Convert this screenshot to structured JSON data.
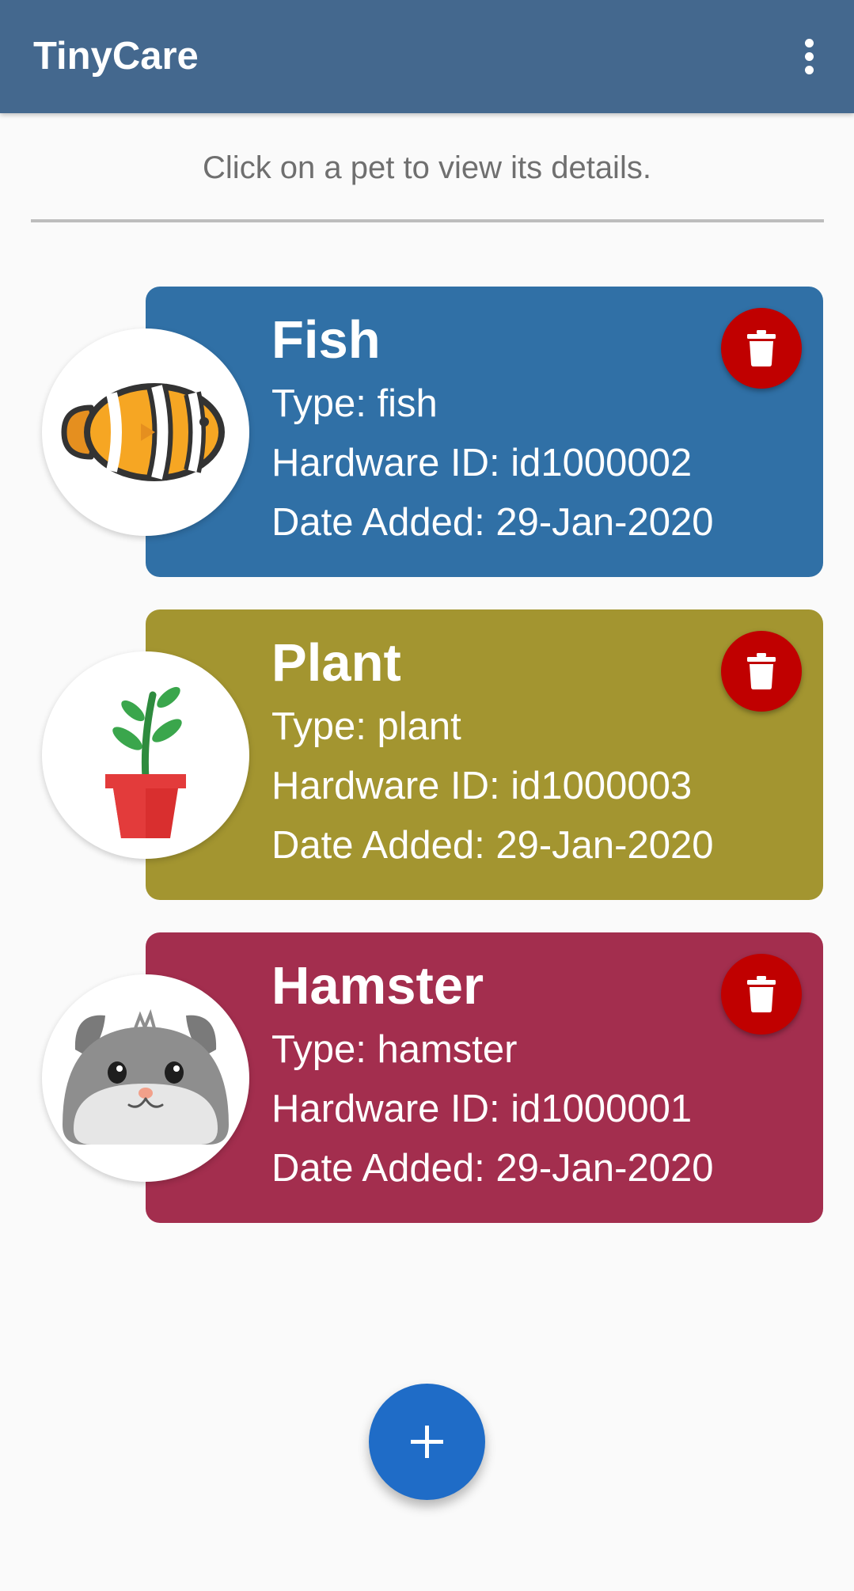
{
  "app_bar": {
    "title": "TinyCare",
    "menu_icon": "more-vert-icon",
    "color": "#44688e"
  },
  "hint": "Click on a pet to view its details.",
  "pets": [
    {
      "name": "Fish",
      "type_line": "Type: fish",
      "hardware_line": "Hardware ID: id1000002",
      "date_line": "Date Added: 29-Jan-2020",
      "avatar_icon": "clownfish-icon",
      "color": "#3070a6"
    },
    {
      "name": "Plant",
      "type_line": "Type: plant",
      "hardware_line": "Hardware ID: id1000003",
      "date_line": "Date Added: 29-Jan-2020",
      "avatar_icon": "potted-plant-icon",
      "color": "#a39530"
    },
    {
      "name": "Hamster",
      "type_line": "Type: hamster",
      "hardware_line": "Hardware ID: id1000001",
      "date_line": "Date Added: 29-Jan-2020",
      "avatar_icon": "hamster-icon",
      "color": "#a32e4e"
    }
  ],
  "delete_icon": "trash-icon",
  "delete_color": "#c00000",
  "fab": {
    "label": "+",
    "icon": "plus-icon",
    "color": "#1f6cc7"
  }
}
